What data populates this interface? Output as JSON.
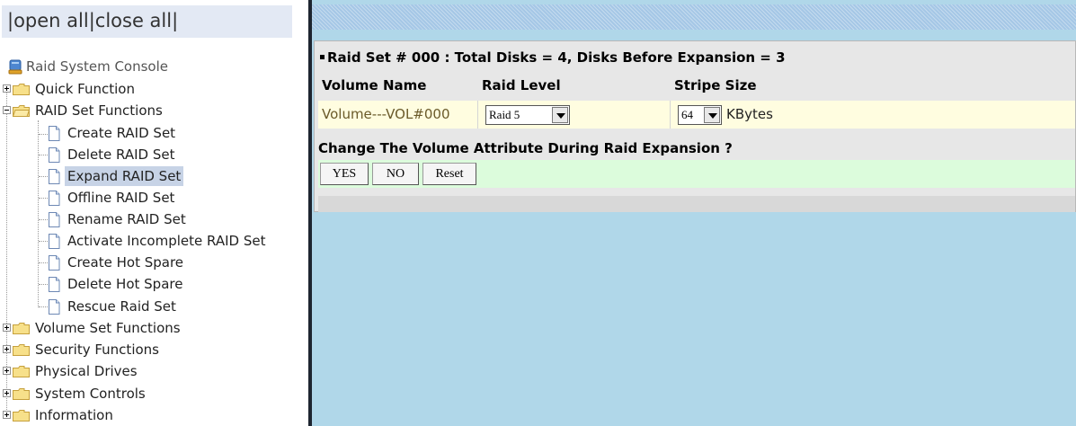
{
  "tree": {
    "open_all": "open all",
    "close_all": "close all",
    "root_label": "Raid System Console",
    "items": [
      {
        "label": "Quick Function",
        "type": "folder",
        "expanded": false
      },
      {
        "label": "RAID Set Functions",
        "type": "folder",
        "expanded": true
      },
      {
        "label": "Create RAID Set",
        "type": "page"
      },
      {
        "label": "Delete RAID Set",
        "type": "page"
      },
      {
        "label": "Expand RAID Set",
        "type": "page",
        "selected": true
      },
      {
        "label": "Offline RAID Set",
        "type": "page"
      },
      {
        "label": "Rename RAID Set",
        "type": "page"
      },
      {
        "label": "Activate Incomplete RAID Set",
        "type": "page"
      },
      {
        "label": "Create Hot Spare",
        "type": "page"
      },
      {
        "label": "Delete Hot Spare",
        "type": "page"
      },
      {
        "label": "Rescue Raid Set",
        "type": "page"
      },
      {
        "label": "Volume Set Functions",
        "type": "folder",
        "expanded": false
      },
      {
        "label": "Security Functions",
        "type": "folder",
        "expanded": false
      },
      {
        "label": "Physical Drives",
        "type": "folder",
        "expanded": false
      },
      {
        "label": "System Controls",
        "type": "folder",
        "expanded": false
      },
      {
        "label": "Information",
        "type": "folder",
        "expanded": false
      }
    ]
  },
  "form": {
    "title": "Raid Set # 000 : Total Disks = 4, Disks Before Expansion = 3",
    "columns": {
      "volume_name": "Volume Name",
      "raid_level": "Raid Level",
      "stripe_size": "Stripe Size"
    },
    "volume_name": "Volume---VOL#000",
    "raid_level": "Raid 5",
    "stripe_size": "64",
    "stripe_unit": "KBytes",
    "question": "Change The Volume Attribute During Raid Expansion ?",
    "buttons": {
      "yes": "YES",
      "no": "NO",
      "reset": "Reset"
    }
  },
  "colors": {
    "content_bg": "#b0d7e9",
    "selected_bg": "#c7d3e6",
    "value_row_bg": "#fffde0",
    "button_row_bg": "#dcfcdc"
  }
}
